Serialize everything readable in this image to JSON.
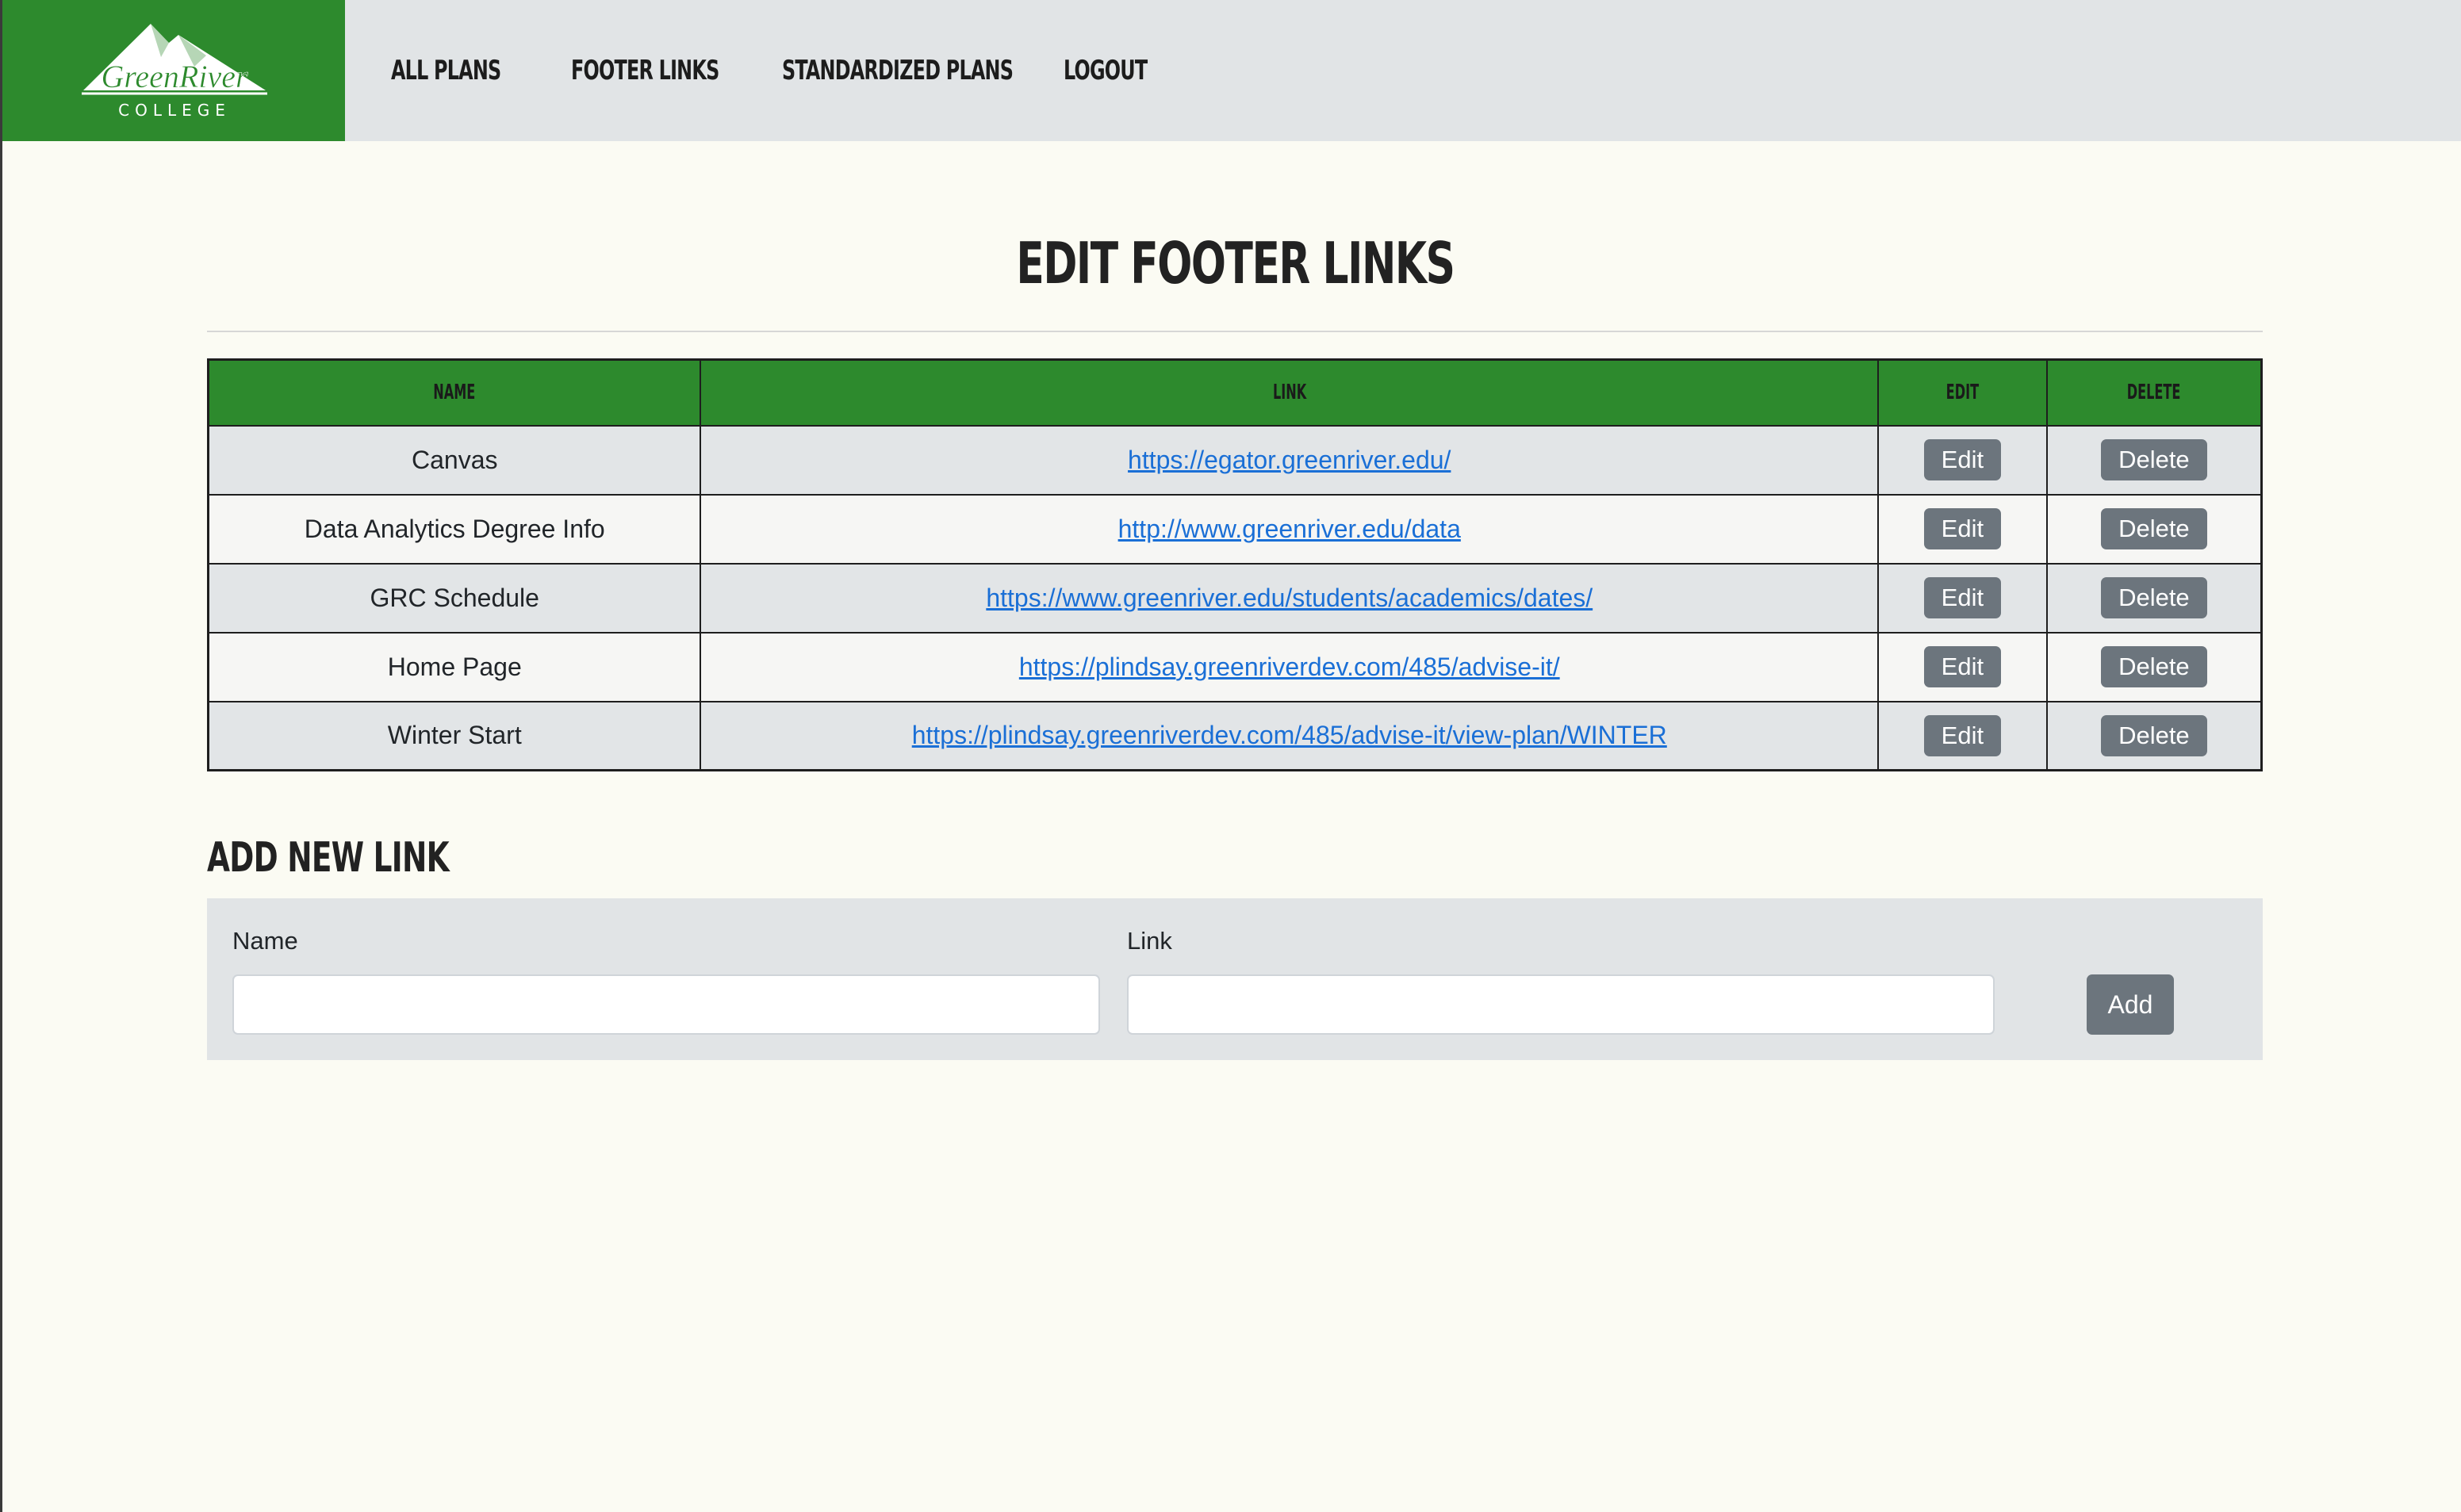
{
  "brand": {
    "name_line1": "GreenRiver",
    "name_line2": "COLLEGE",
    "color": "#2d8a2d"
  },
  "nav": {
    "items": [
      {
        "label": "All Plans"
      },
      {
        "label": "Footer Links"
      },
      {
        "label": "Standardized Plans"
      },
      {
        "label": "Logout"
      }
    ]
  },
  "page": {
    "title": "Edit Footer Links"
  },
  "table": {
    "headers": {
      "name": "Name",
      "link": "Link",
      "edit": "Edit",
      "delete": "Delete"
    },
    "rows": [
      {
        "name": "Canvas",
        "link": "https://egator.greenriver.edu/",
        "edit": "Edit",
        "delete": "Delete"
      },
      {
        "name": "Data Analytics Degree Info",
        "link": "http://www.greenriver.edu/data",
        "edit": "Edit",
        "delete": "Delete"
      },
      {
        "name": "GRC Schedule",
        "link": "https://www.greenriver.edu/students/academics/dates/",
        "edit": "Edit",
        "delete": "Delete"
      },
      {
        "name": "Home Page",
        "link": "https://plindsay.greenriverdev.com/485/advise-it/",
        "edit": "Edit",
        "delete": "Delete"
      },
      {
        "name": "Winter Start",
        "link": "https://plindsay.greenriverdev.com/485/advise-it/view-plan/WINTER",
        "edit": "Edit",
        "delete": "Delete"
      }
    ]
  },
  "add_form": {
    "title": "Add New Link",
    "name_label": "Name",
    "name_value": "",
    "link_label": "Link",
    "link_value": "",
    "add_label": "Add"
  },
  "colors": {
    "accent_green": "#2d8a2d",
    "nav_bg": "#e1e4e6",
    "button_gray": "#6c757d",
    "link_blue": "#1a6fd6",
    "page_bg": "#fbfbf3"
  }
}
